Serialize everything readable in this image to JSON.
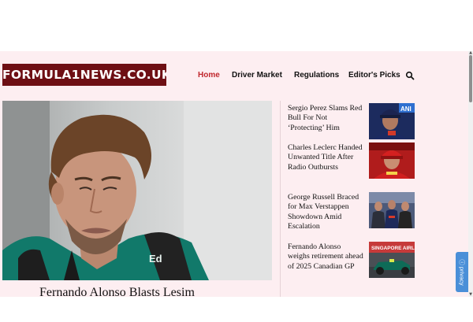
{
  "site": {
    "logo_text": "FORMULA1NEWS.CO.UK"
  },
  "nav": {
    "items": [
      {
        "label": "Home",
        "active": true
      },
      {
        "label": "Driver Market",
        "active": false
      },
      {
        "label": "Regulations",
        "active": false
      },
      {
        "label": "Editor's Picks",
        "active": false
      }
    ],
    "search_icon": "search-icon"
  },
  "hero": {
    "title": "Fernando Alonso Blasts Lesim"
  },
  "articles": [
    {
      "title": "Sergio Perez Slams Red Bull For Not ‘Protecting’ Him"
    },
    {
      "title": "Charles Leclerc Handed Unwanted Title After Radio Outbursts"
    },
    {
      "title": "George Russell Braced for Max Verstappen Showdown Amid Escalation"
    },
    {
      "title": "Fernando Alonso weighs retirement ahead of 2025 Canadian GP"
    }
  ],
  "thumb_texts": {
    "singapore": "SINGAPORE AIRL"
  },
  "privacy": {
    "label": "privacy"
  },
  "colors": {
    "accent": "#c0272d",
    "logo_bg": "#6e0f14",
    "page_bg": "#fdeef1",
    "privacy_tab": "#4a8fd8"
  }
}
